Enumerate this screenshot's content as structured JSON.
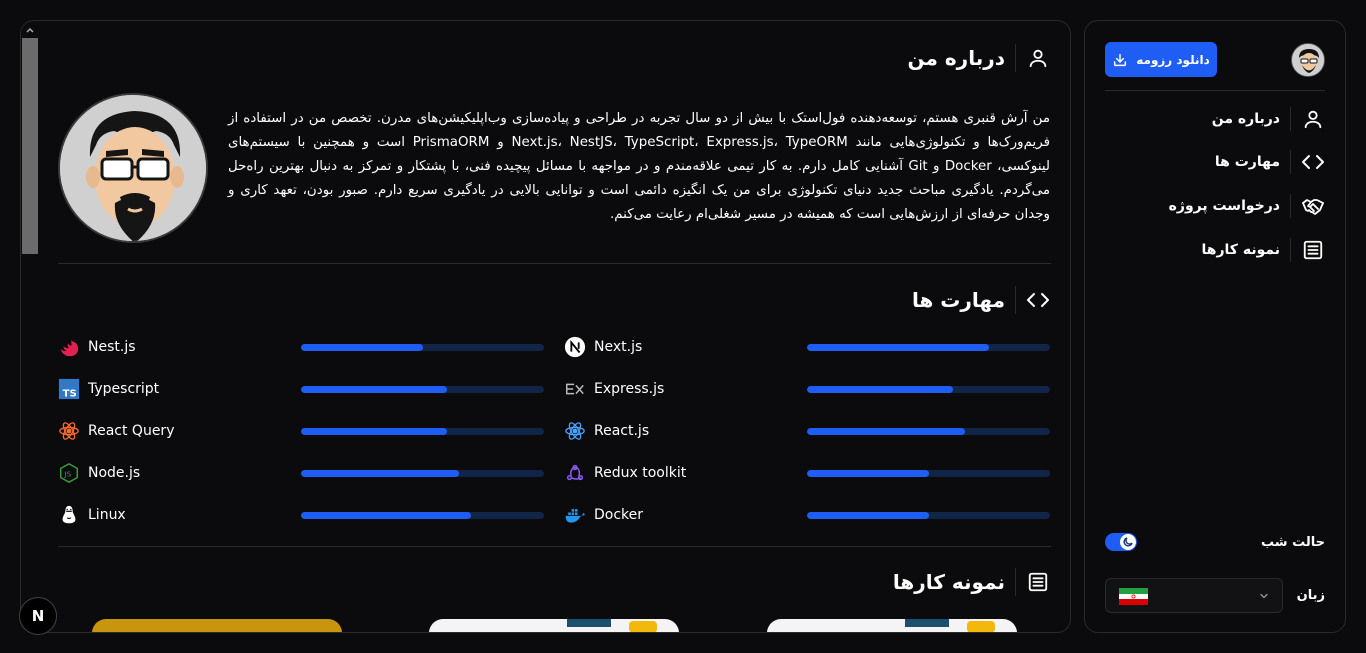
{
  "sidebar": {
    "download_label": "دانلود رزومه",
    "nav": [
      {
        "label": "درباره من",
        "icon": "user-icon"
      },
      {
        "label": "مهارت ها",
        "icon": "code-icon"
      },
      {
        "label": "درخواست پروژه",
        "icon": "handshake-icon"
      },
      {
        "label": "نمونه کارها",
        "icon": "list-icon"
      }
    ],
    "night_mode_label": "حالت شب",
    "night_mode_on": true,
    "language_label": "زبان",
    "language_selected": "fa-IR-flag"
  },
  "about": {
    "title": "درباره من",
    "text": "من آرش قنبری هستم، توسعه‌دهنده فول‌استک با بیش از دو سال تجربه در طراحی و پیاده‌سازی وب‌اپلیکیشن‌های مدرن. تخصص من در استفاده از فریم‌ورک‌ها و تکنولوژی‌هایی مانند Next.js، NestJS، TypeScript، Express.js، TypeORM و PrismaORM است و همچنین با سیستم‌های لینوکسی، Docker و Git آشنایی کامل دارم. به کار تیمی علاقه‌مندم و در مواجهه با مسائل پیچیده فنی، با پشتکار و تمرکز به دنبال بهترین راه‌حل می‌گردم. یادگیری مباحث جدید دنیای تکنولوژی برای من یک انگیزه دائمی است و توانایی بالایی در یادگیری سریع دارم. صبور بودن، تعهد کاری و وجدان حرفه‌ای از ارزش‌هایی است که همیشه در مسیر شغلی‌ام رعایت می‌کنم."
  },
  "skills": {
    "title": "مهارت ها",
    "items": [
      {
        "name": "Nest.js",
        "icon": "nestjs-icon",
        "level": 0.5
      },
      {
        "name": "Next.js",
        "icon": "nextjs-icon",
        "level": 0.75
      },
      {
        "name": "Typescript",
        "icon": "typescript-icon",
        "level": 0.6
      },
      {
        "name": "Express.js",
        "icon": "express-icon",
        "level": 0.6
      },
      {
        "name": "React Query",
        "icon": "react-query-icon",
        "level": 0.6
      },
      {
        "name": "React.js",
        "icon": "react-icon",
        "level": 0.65
      },
      {
        "name": "Node.js",
        "icon": "nodejs-icon",
        "level": 0.65
      },
      {
        "name": "Redux toolkit",
        "icon": "redux-icon",
        "level": 0.5
      },
      {
        "name": "Linux",
        "icon": "linux-icon",
        "level": 0.7
      },
      {
        "name": "Docker",
        "icon": "docker-icon",
        "level": 0.5
      }
    ]
  },
  "portfolio": {
    "title": "نمونه کارها"
  },
  "badge": {
    "label": "N"
  },
  "colors": {
    "accent": "#1f5ef5",
    "background": "#0b0b0d",
    "track": "#102548"
  }
}
